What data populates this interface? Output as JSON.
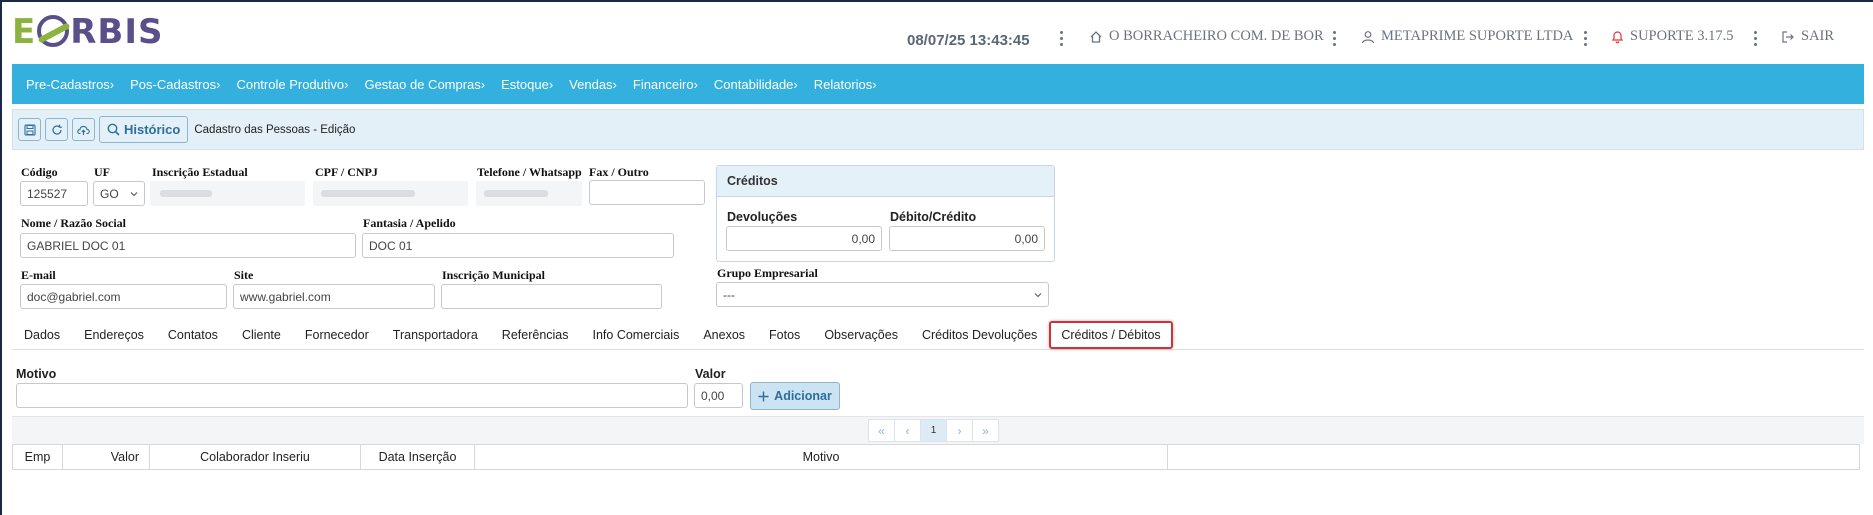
{
  "header": {
    "logo": "EORBIS",
    "datetime": "08/07/25 13:43:45",
    "company": "O BORRACHEIRO COM. DE BOR",
    "user": "METAPRIME SUPORTE LTDA",
    "support": "SUPORTE 3.17.5",
    "logout": "SAIR"
  },
  "nav": {
    "items": [
      "Pre-Cadastros›",
      "Pos-Cadastros›",
      "Controle Produtivo›",
      "Gestao de Compras›",
      "Estoque›",
      "Vendas›",
      "Financeiro›",
      "Contabilidade›",
      "Relatorios›"
    ]
  },
  "toolbar": {
    "history_label": "Histórico",
    "page_title": "Cadastro das Pessoas - Edição"
  },
  "form": {
    "codigo_label": "Código",
    "codigo_value": "125527",
    "uf_label": "UF",
    "uf_value": "GO",
    "ie_label": "Inscrição Estadual",
    "cpf_label": "CPF / CNPJ",
    "telefone_label": "Telefone / Whatsapp",
    "fax_label": "Fax / Outro",
    "fax_value": "",
    "nome_label": "Nome / Razão Social",
    "nome_value": "GABRIEL DOC 01",
    "fantasia_label": "Fantasia / Apelido",
    "fantasia_value": "DOC 01",
    "email_label": "E-mail",
    "email_value": "doc@gabriel.com",
    "site_label": "Site",
    "site_value": "www.gabriel.com",
    "im_label": "Inscrição Municipal",
    "im_value": ""
  },
  "creditos": {
    "title": "Créditos",
    "devolucoes_label": "Devoluções",
    "devolucoes_value": "0,00",
    "debito_label": "Débito/Crédito",
    "debito_value": "0,00",
    "grupo_label": "Grupo Empresarial",
    "grupo_value": "---"
  },
  "tabs": [
    "Dados",
    "Endereços",
    "Contatos",
    "Cliente",
    "Fornecedor",
    "Transportadora",
    "Referências",
    "Info Comerciais",
    "Anexos",
    "Fotos",
    "Observações",
    "Créditos Devoluções",
    "Créditos / Débitos"
  ],
  "active_tab_index": 12,
  "entry": {
    "motivo_label": "Motivo",
    "motivo_value": "",
    "valor_label": "Valor",
    "valor_value": "0,00",
    "add_label": "Adicionar"
  },
  "pager": {
    "first": "«",
    "prev": "‹",
    "current": "1",
    "next": "›",
    "last": "»"
  },
  "grid": {
    "columns": [
      "Emp",
      "Valor",
      "Colaborador Inseriu",
      "Data Inserção",
      "Motivo",
      ""
    ]
  },
  "colors": {
    "nav_bg": "#33b0de",
    "toolbar_bg": "#e3f0f8",
    "active_tab_border": "#c9343a",
    "logo_purple": "#5b4f8a",
    "logo_green": "#8cb33f"
  }
}
